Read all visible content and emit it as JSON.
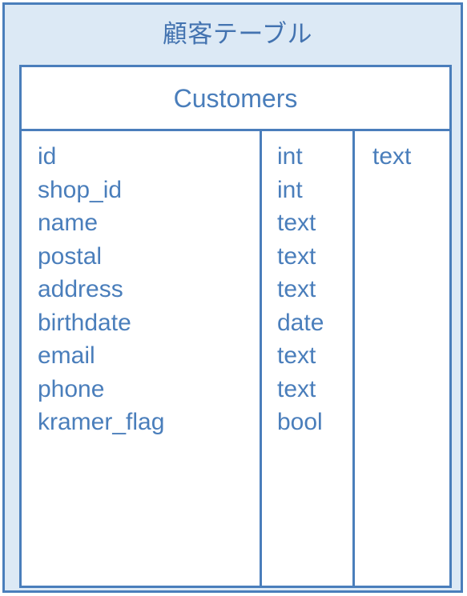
{
  "diagram": {
    "title": "顧客テーブル",
    "entity": {
      "name": "Customers",
      "columns": [
        {
          "name": "id",
          "type": "int",
          "extra": "text"
        },
        {
          "name": "shop_id",
          "type": "int",
          "extra": ""
        },
        {
          "name": "name",
          "type": "text",
          "extra": ""
        },
        {
          "name": "postal",
          "type": "text",
          "extra": ""
        },
        {
          "name": "address",
          "type": "text",
          "extra": ""
        },
        {
          "name": "birthdate",
          "type": "date",
          "extra": ""
        },
        {
          "name": "email",
          "type": "text",
          "extra": ""
        },
        {
          "name": "phone",
          "type": "text",
          "extra": ""
        },
        {
          "name": "kramer_flag",
          "type": "bool",
          "extra": ""
        }
      ]
    }
  },
  "colors": {
    "border": "#4a7ebb",
    "frame_fill": "#dce9f5",
    "text": "#4a7ebb",
    "title_text": "#4373b0",
    "table_fill": "#ffffff"
  }
}
